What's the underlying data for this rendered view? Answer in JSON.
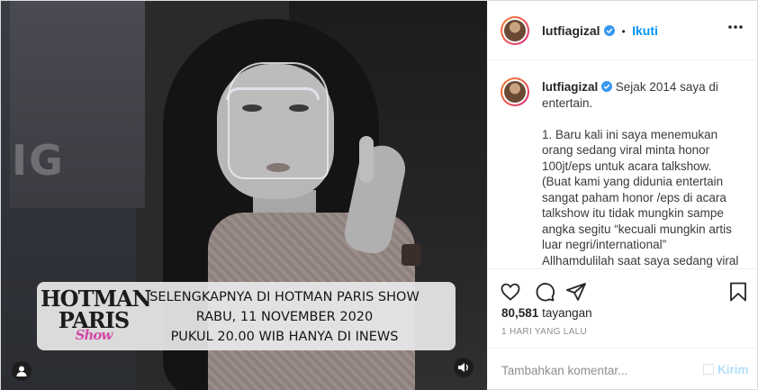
{
  "video": {
    "background_sign": "IG",
    "banner_logo": [
      "HOTMAN",
      "PARIS",
      "Show"
    ],
    "banner_lines": [
      "SELENGKAPNYA DI HOTMAN PARIS SHOW",
      "RABU, 11 NOVEMBER 2020",
      "PUKUL 20.00 WIB HANYA DI INEWS"
    ]
  },
  "header": {
    "username": "lutfiagizal",
    "separator": "•",
    "follow_label": "Ikuti"
  },
  "caption": {
    "username": "lutfiagizal",
    "first_line": "Sejak 2014 saya di entertain.",
    "paragraphs": [
      "1. Baru kali ini saya menemukan orang sedang viral minta honor 100jt/eps untuk acara talkshow.",
      "(Buat kami yang didunia entertain sangat paham honor /eps di acara talkshow itu tidak mungkin sampe angka segitu “kecuali mungkin artis luar negri/international”",
      "Allhamdulilah saat saya sedang viral “anjay/anayani/anjalathi” selalu"
    ]
  },
  "stats": {
    "views_count": "80,581",
    "views_label": "tayangan",
    "posted_time": "1 HARI YANG LALU"
  },
  "comment": {
    "placeholder": "Tambahkan komentar...",
    "send_label": "Kirim"
  },
  "colors": {
    "accent": "#0095f6",
    "send_disabled": "#b2dffc",
    "text": "#262626",
    "muted": "#8e8e8e"
  }
}
